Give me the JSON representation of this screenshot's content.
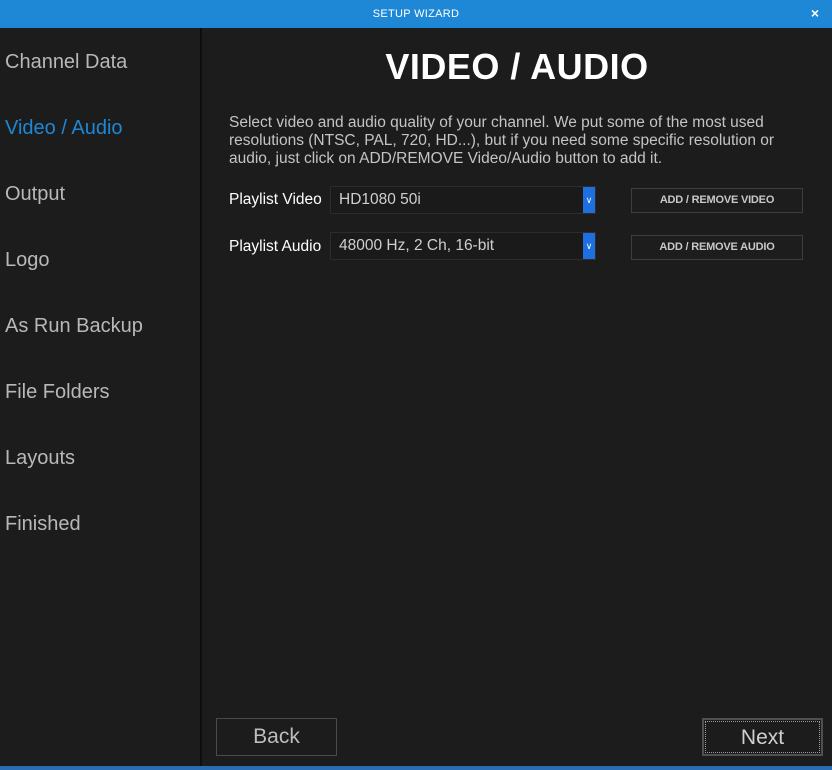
{
  "window": {
    "title": "SETUP WIZARD",
    "close_icon": "×"
  },
  "sidebar": {
    "items": [
      {
        "label": "Channel Data",
        "active": false
      },
      {
        "label": "Video / Audio",
        "active": true
      },
      {
        "label": "Output",
        "active": false
      },
      {
        "label": "Logo",
        "active": false
      },
      {
        "label": "As Run Backup",
        "active": false
      },
      {
        "label": "File Folders",
        "active": false
      },
      {
        "label": "Layouts",
        "active": false
      },
      {
        "label": "Finished",
        "active": false
      }
    ]
  },
  "main": {
    "title": "VIDEO / AUDIO",
    "description": "Select video and audio quality of your channel. We put some of the most used resolutions (NTSC, PAL, 720, HD...), but if you need some specific resolution or audio, just click on ADD/REMOVE Video/Audio button to add it.",
    "video": {
      "label": "Playlist Video",
      "selected": "HD1080 50i",
      "button": "ADD / REMOVE VIDEO"
    },
    "audio": {
      "label": "Playlist Audio",
      "selected": "48000 Hz, 2 Ch, 16-bit",
      "button": "ADD / REMOVE AUDIO"
    }
  },
  "footer": {
    "back_label": "Back",
    "next_label": "Next"
  },
  "colors": {
    "accent": "#1e88d6",
    "background": "#1c1c1c",
    "dropdown_arrow": "#1e6fe0"
  },
  "icons": {
    "close": "close-icon",
    "dropdown": "chevron-down-icon"
  }
}
